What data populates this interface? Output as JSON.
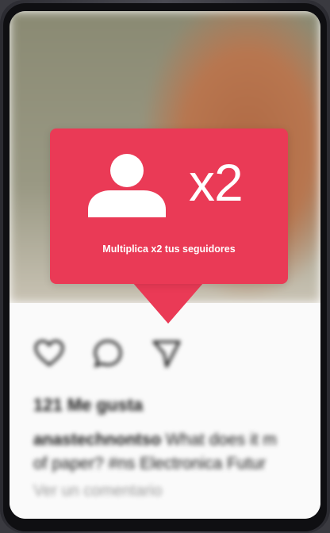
{
  "colors": {
    "popup_bg": "#ea3a56",
    "popup_text": "#ffffff",
    "screen_bg": "#fafafa",
    "frame": "#2b2b31"
  },
  "popup": {
    "icon": "user-icon",
    "multiplier": "x2",
    "message": "Multiplica x2 tus seguidores"
  },
  "post": {
    "actions": [
      "heart-icon",
      "comment-icon",
      "share-icon"
    ],
    "likes": "121 Me gusta",
    "caption_user": "anastechnontso",
    "caption_text": " What does it m",
    "caption_line2": "of paper? #ns Electronica Futur",
    "comments_link": "Ver un comentario"
  }
}
